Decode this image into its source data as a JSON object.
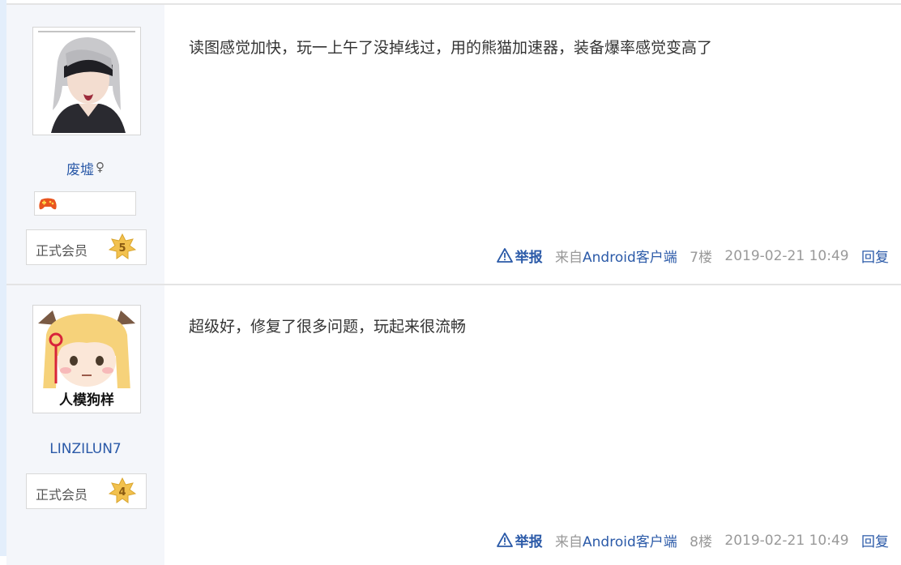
{
  "posts": [
    {
      "username": "废墟",
      "gender_symbol": "♀",
      "medal_icon": "game-controller-icon",
      "rank_label": "正式会员",
      "rank_level": "5",
      "content": "读图感觉加快，玩一上午了没掉线过，用的熊猫加速器，装备爆率感觉变高了",
      "report_label": "举报",
      "client_prefix": "来自",
      "client_name": "Android客户端",
      "floor": "7楼",
      "timestamp": "2019-02-21 10:49",
      "reply_label": "回复"
    },
    {
      "username": "LINZILUN7",
      "rank_label": "正式会员",
      "rank_level": "4",
      "avatar_caption": "人模狗样",
      "content": "超级好，修复了很多问题，玩起来很流畅",
      "report_label": "举报",
      "client_prefix": "来自",
      "client_name": "Android客户端",
      "floor": "8楼",
      "timestamp": "2019-02-21 10:49",
      "reply_label": "回复"
    }
  ],
  "colors": {
    "link": "#2b5aa8",
    "muted": "#999999",
    "sidebar_bg": "#f4f6fa",
    "accent_strip": "#e3eefb",
    "rank_star": "#f2c14e"
  }
}
